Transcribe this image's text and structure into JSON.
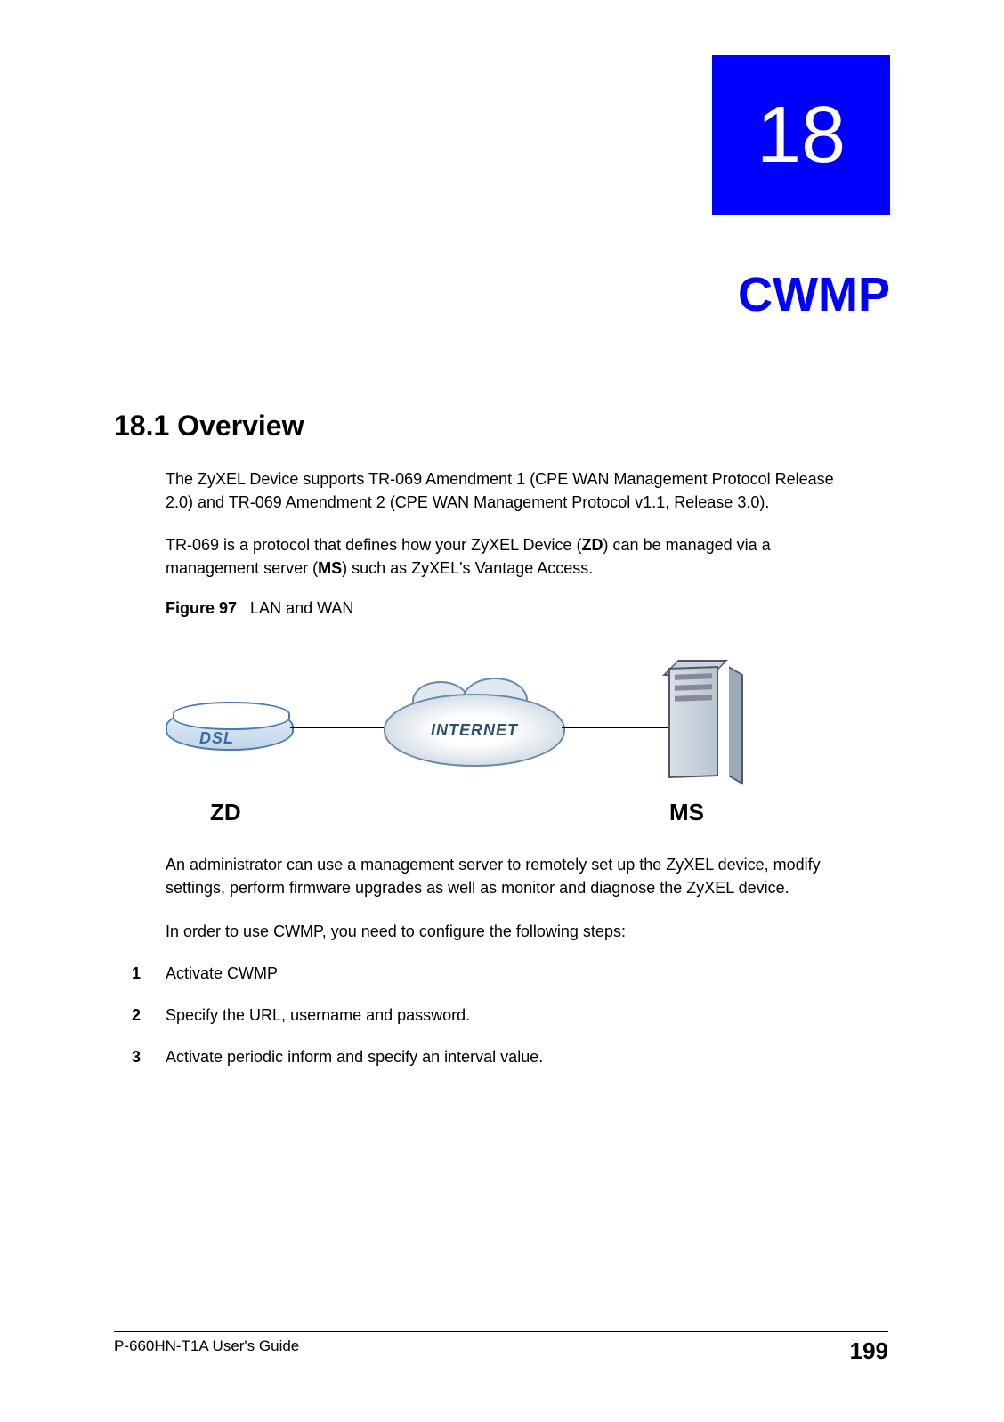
{
  "chapter": {
    "number": "18",
    "title": "CWMP"
  },
  "section": {
    "number_title": "18.1  Overview"
  },
  "paragraphs": {
    "p1": "The ZyXEL Device supports TR-069 Amendment 1 (CPE WAN Management Protocol  Release 2.0) and TR-069 Amendment 2 (CPE WAN Management Protocol v1.1, Release 3.0).",
    "p2_pre": "TR-069 is a protocol that defines how your ZyXEL Device (",
    "p2_zd": "ZD",
    "p2_mid": ") can be managed via a management server (",
    "p2_ms": "MS",
    "p2_post": ") such as ZyXEL's Vantage Access.",
    "p3": "An administrator can use a management server to remotely set up the ZyXEL device, modify settings, perform firmware upgrades as well as monitor and diagnose the ZyXEL device.",
    "p4": "In order to use CWMP, you need to configure the following steps:"
  },
  "figure": {
    "label": "Figure 97",
    "caption": "LAN and WAN",
    "dsl_text": "DSL",
    "internet_text": "INTERNET",
    "zd_label": "ZD",
    "ms_label": "MS"
  },
  "steps": [
    {
      "num": "1",
      "text": "Activate CWMP"
    },
    {
      "num": "2",
      "text": "Specify the URL, username and password."
    },
    {
      "num": "3",
      "text": "Activate periodic inform and specify an interval value."
    }
  ],
  "footer": {
    "guide": "P-660HN-T1A User's Guide",
    "page": "199"
  }
}
